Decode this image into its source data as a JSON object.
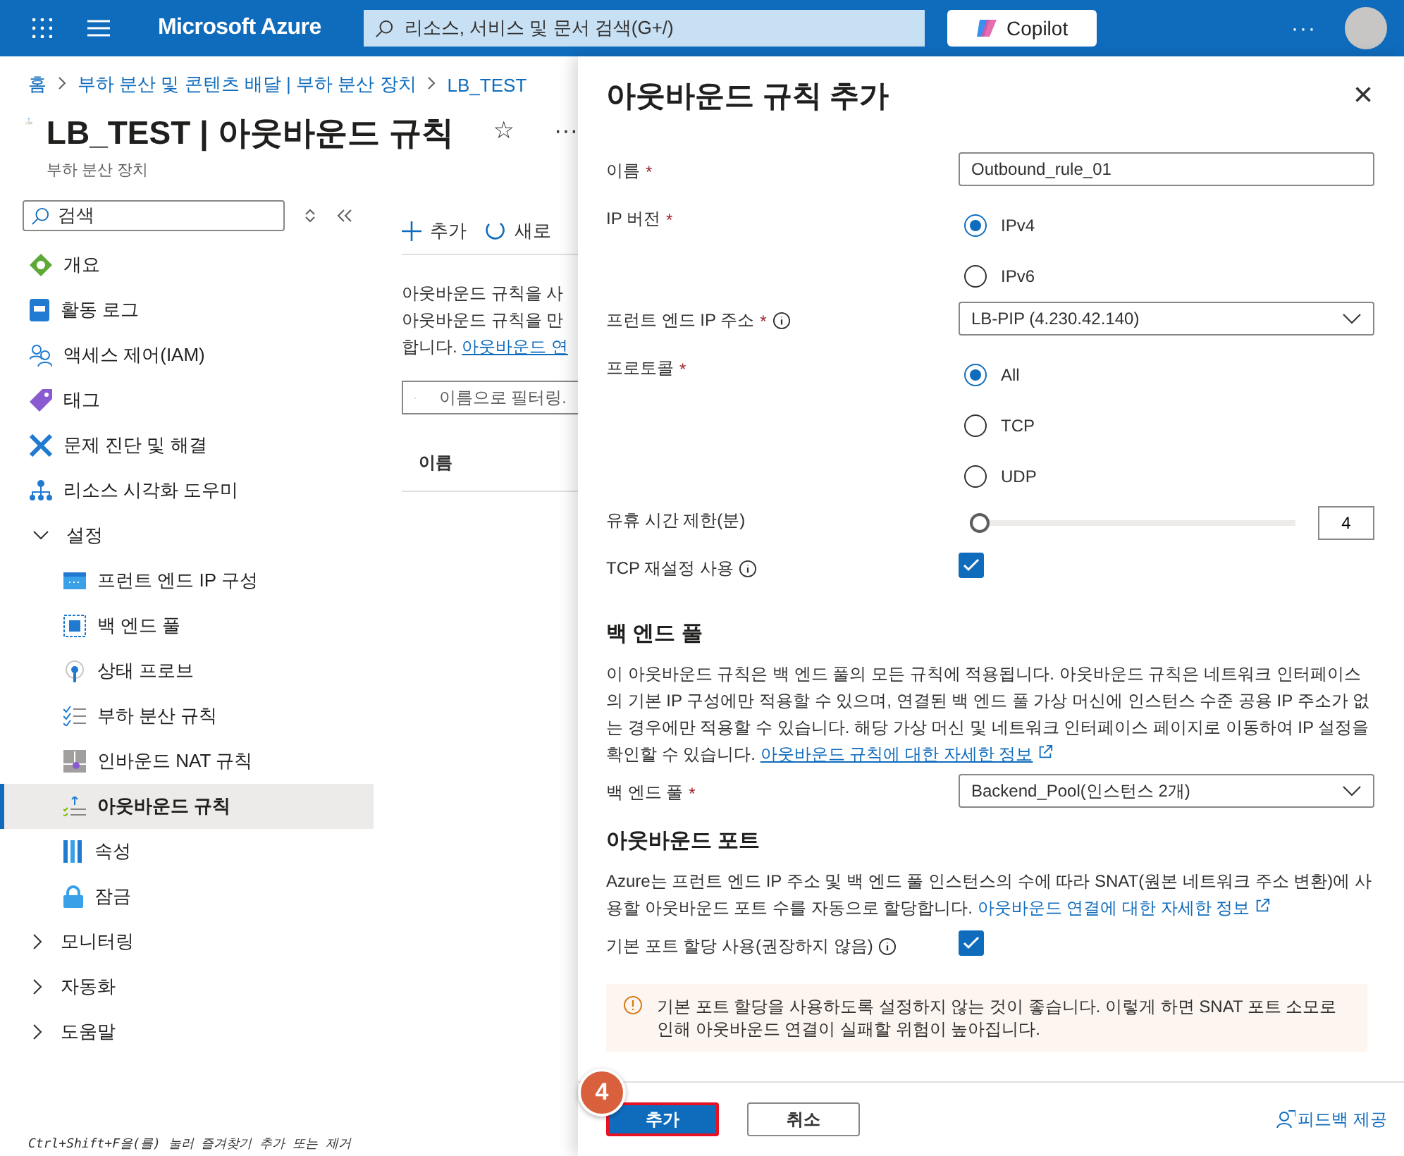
{
  "topbar": {
    "brand": "Microsoft Azure",
    "search": {
      "placeholder": "리소스, 서비스 및 문서 검색(G+/)"
    },
    "copilot": "Copilot",
    "more": "···"
  },
  "breadcrumb": [
    "홈",
    "부하 분산 및 콘텐츠 배달 | 부하 분산 장치",
    "LB_TEST"
  ],
  "page": {
    "title": "LB_TEST | 아웃바운드 규칙",
    "subtitle": "부하 분산 장치",
    "favorite": "☆",
    "more": "···"
  },
  "sidebar": {
    "search": {
      "placeholder": "검색"
    },
    "items": [
      {
        "label": "개요",
        "selected": false
      },
      {
        "label": "활동 로그",
        "selected": false
      },
      {
        "label": "액세스 제어(IAM)",
        "selected": false
      },
      {
        "label": "태그",
        "selected": false
      },
      {
        "label": "문제 진단 및 해결",
        "selected": false
      },
      {
        "label": "리소스 시각화 도우미",
        "selected": false
      },
      {
        "label": "설정",
        "expanded": true,
        "children": [
          {
            "label": "프런트 엔드 IP 구성",
            "selected": false
          },
          {
            "label": "백 엔드 풀",
            "selected": false
          },
          {
            "label": "상태 프로브",
            "selected": false
          },
          {
            "label": "부하 분산 규칙",
            "selected": false
          },
          {
            "label": "인바운드 NAT 규칙",
            "selected": false
          },
          {
            "label": "아웃바운드 규칙",
            "selected": true
          },
          {
            "label": "속성",
            "selected": false
          },
          {
            "label": "잠금",
            "selected": false
          }
        ]
      },
      {
        "label": "모니터링",
        "expanded": false
      },
      {
        "label": "자동화",
        "expanded": false
      },
      {
        "label": "도움말",
        "expanded": false
      }
    ],
    "hint": "Ctrl+Shift+F을(를) 눌러 즐겨찾기 추가 또는 제거"
  },
  "content": {
    "toolbar": [
      "추가",
      "새로"
    ],
    "description": [
      "아웃바운드 규칙을 사",
      "아웃바운드 규칙을 만"
    ],
    "description_end": "합니다.",
    "link": "아웃바운드 연",
    "filter": {
      "placeholder": "이름으로 필터링."
    },
    "columns": [
      "이름"
    ]
  },
  "panel": {
    "title": "아웃바운드 규칙 추가",
    "close": "×",
    "fields": [
      {
        "kind": "text",
        "label": "이름",
        "required": "*",
        "info": false,
        "value": "Outbound_rule_01"
      },
      {
        "kind": "radio",
        "label": "IP 버전",
        "required": "*",
        "info": false,
        "options": [
          {
            "label": "IPv4",
            "selected": true
          },
          {
            "label": "IPv6",
            "selected": false
          }
        ]
      },
      {
        "kind": "select",
        "label": "프런트 엔드 IP 주소",
        "required": "*",
        "info": true,
        "value": "LB-PIP (4.230.42.140)"
      },
      {
        "kind": "radio",
        "label": "프로토콜",
        "required": "*",
        "info": false,
        "options": [
          {
            "label": "All",
            "selected": true
          },
          {
            "label": "TCP",
            "selected": false
          },
          {
            "label": "UDP",
            "selected": false
          }
        ]
      },
      {
        "kind": "slider",
        "label": "유휴 시간 제한(분)",
        "info": false,
        "level": 0,
        "value": "4"
      },
      {
        "kind": "checkbox",
        "label": "TCP 재설정 사용",
        "info": true,
        "checked": true
      }
    ],
    "backend": {
      "heading": "백 엔드 풀",
      "text": "이 아웃바운드 규칙은 백 엔드 풀의 모든 규칙에 적용됩니다. 아웃바운드 규칙은 네트워크 인터페이스의 기본 IP 구성에만 적용할 수 있으며, 연결된 백 엔드 풀 가상 머신에 인스턴스 수준 공용 IP 주소가 없는 경우에만 적용할 수 있습니다. 해당 가상 머신 및 네트워크 인터페이스 페이지로 이동하여 IP 설정을 확인할 수 있습니다.",
      "link": "아웃바운드 규칙에 대한 자세한 정보",
      "field": {
        "kind": "select",
        "label": "백 엔드 풀",
        "required": "*",
        "info": false,
        "value": "Backend_Pool(인스턴스 2개)"
      }
    },
    "ports": {
      "heading": "아웃바운드 포트",
      "text": "Azure는 프런트 엔드 IP 주소 및 백 엔드 풀 인스턴스의 수에 따라 SNAT(원본 네트워크 주소 변환)에 사용할 아웃바운드 포트 수를 자동으로 할당합니다.",
      "link": "아웃바운드 연결에 대한 자세한 정보",
      "field": {
        "kind": "checkbox",
        "label": "기본 포트 할당 사용(권장하지 않음)",
        "info": true,
        "checked": true
      },
      "warning": "기본 포트 할당을 사용하도록 설정하지 않는 것이 좋습니다. 이렇게 하면 SNAT 포트 소모로 인해 아웃바운드 연결이 실패할 위험이 높아집니다."
    },
    "buttons": [
      {
        "label": "추가",
        "primary": true
      },
      {
        "label": "취소",
        "primary": false
      }
    ],
    "step": "4",
    "feedback": "피드백 제공"
  }
}
